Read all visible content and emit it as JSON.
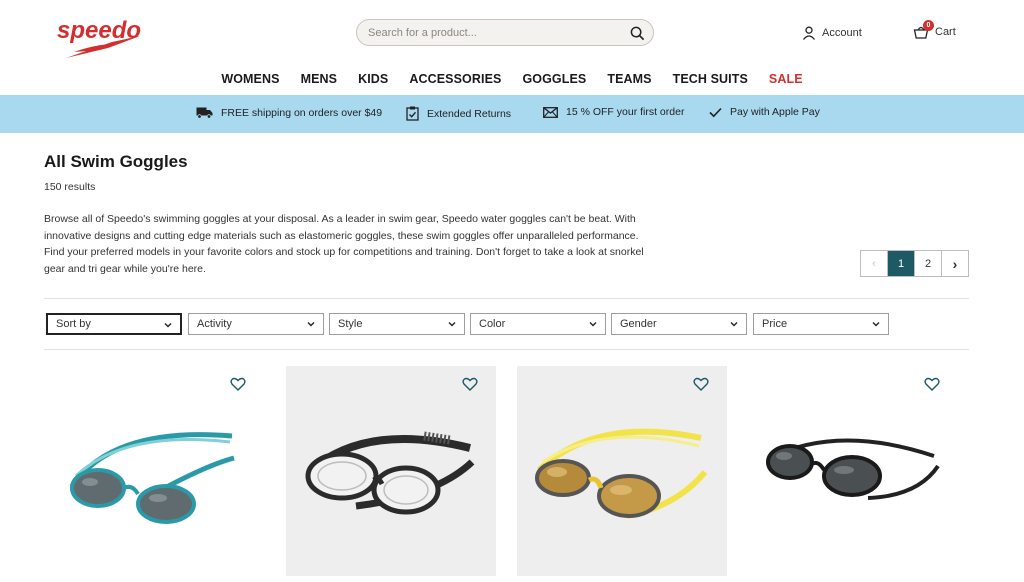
{
  "brand": {
    "logo_text": "speedo",
    "accent": "#d32f2f"
  },
  "search": {
    "placeholder": "Search for a product...",
    "icon": "search-icon"
  },
  "header": {
    "account_label": "Account",
    "cart_label": "Cart",
    "cart_count": "0"
  },
  "nav": {
    "items": [
      {
        "label": "WOMENS"
      },
      {
        "label": "MENS"
      },
      {
        "label": "KIDS"
      },
      {
        "label": "ACCESSORIES"
      },
      {
        "label": "GOGGLES"
      },
      {
        "label": "TEAMS"
      },
      {
        "label": "TECH SUITS"
      },
      {
        "label": "SALE",
        "color": "#d32f2f"
      }
    ]
  },
  "banner": {
    "background": "#a9d9ee",
    "items": [
      {
        "icon": "truck-icon",
        "label": "FREE shipping on orders over $49"
      },
      {
        "icon": "clipboard-check-icon",
        "label": "Extended Returns"
      },
      {
        "icon": "envelope-icon",
        "label": "15 % OFF your first order"
      },
      {
        "icon": "check-icon",
        "label": "Pay with Apple Pay"
      }
    ]
  },
  "page": {
    "title": "All Swim Goggles",
    "results": "150 results",
    "description_lines": [
      "Browse all of Speedo's swimming goggles at your disposal. As a leader in swim gear, Speedo water goggles can't be beat. With",
      "innovative designs and cutting edge materials such as elastomeric goggles, these swim goggles offer unparalleled performance.",
      "Find your preferred models in your favorite colors and stock up for competitions and training. Don't forget to take a look at snorkel",
      "gear and tri gear while you're here."
    ]
  },
  "pagination": {
    "prev": "‹",
    "pages": [
      "1",
      "2"
    ],
    "current": "1",
    "next": "›",
    "active_color": "#1e5a66"
  },
  "filters": [
    {
      "label": "Sort by"
    },
    {
      "label": "Activity"
    },
    {
      "label": "Style"
    },
    {
      "label": "Color"
    },
    {
      "label": "Gender"
    },
    {
      "label": "Price"
    }
  ],
  "products": [
    {
      "name": "teal goggles",
      "strap_color": "#2a9aa8",
      "lens_color": "#5f6b6e",
      "background": "#ffffff"
    },
    {
      "name": "black clear goggles",
      "strap_color": "#2b2b2b",
      "lens_color": "#e8e8e8",
      "background": "#eeeeee"
    },
    {
      "name": "yellow mirrored goggles",
      "strap_color": "#f2e34a",
      "lens_color": "#b58a3a",
      "background": "#eeeeee"
    },
    {
      "name": "black smoke goggles",
      "strap_color": "#222222",
      "lens_color": "#4a4f52",
      "background": "#ffffff"
    }
  ]
}
